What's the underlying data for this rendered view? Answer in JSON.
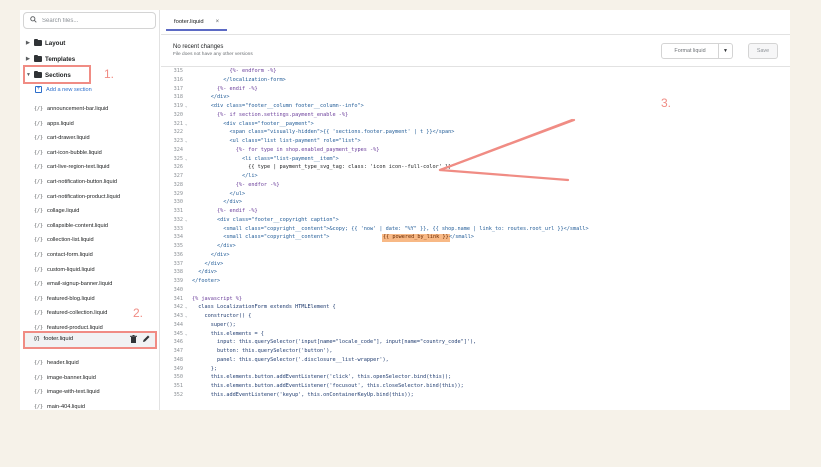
{
  "sidebar": {
    "search_placeholder": "Search files...",
    "folders": [
      {
        "label": "Layout",
        "caret": "▶"
      },
      {
        "label": "Templates",
        "caret": "▶"
      },
      {
        "label": "Sections",
        "caret": "▼"
      }
    ],
    "add_section_label": "Add a new section",
    "files": [
      "announcement-bar.liquid",
      "apps.liquid",
      "cart-drawer.liquid",
      "cart-icon-bubble.liquid",
      "cart-live-region-text.liquid",
      "cart-notification-button.liquid",
      "cart-notification-product.liquid",
      "collage.liquid",
      "collapsible-content.liquid",
      "collection-list.liquid",
      "contact-form.liquid",
      "custom-liquid.liquid",
      "email-signup-banner.liquid",
      "featured-blog.liquid",
      "featured-collection.liquid",
      "featured-product.liquid"
    ],
    "active_file": "footer.liquid",
    "files_after": [
      "header.liquid",
      "image-banner.liquid",
      "image-with-text.liquid",
      "main-404.liquid"
    ],
    "file_icon": "{/}"
  },
  "annotations": {
    "step1": "1.",
    "step2": "2.",
    "step3": "3.",
    "color": "#f08c84"
  },
  "editor": {
    "tab_label": "footer.liquid",
    "tab_close": "×",
    "no_changes_title": "No recent changes",
    "no_changes_sub": "File does not have any other versions",
    "format_label": "Format liquid",
    "format_caret": "▼",
    "save_label": "Save"
  },
  "code_lines": [
    {
      "n": "315",
      "f": "",
      "t": "            {%- endform -%}",
      "c": "kw"
    },
    {
      "n": "316",
      "f": "",
      "t": "          </localization-form>",
      "c": "tag"
    },
    {
      "n": "317",
      "f": "",
      "t": "        {%- endif -%}",
      "c": "kw"
    },
    {
      "n": "318",
      "f": "",
      "t": "      </div>",
      "c": "tag"
    },
    {
      "n": "319",
      "f": "⌄",
      "t": "      <div class=\"footer__column footer__column--info\">",
      "c": "tag"
    },
    {
      "n": "320",
      "f": "",
      "t": "        {%- if section.settings.payment_enable -%}",
      "c": "kw"
    },
    {
      "n": "321",
      "f": "⌄",
      "t": "          <div class=\"footer__payment\">",
      "c": "tag"
    },
    {
      "n": "322",
      "f": "",
      "t": "            <span class=\"visually-hidden\">{{ 'sections.footer.payment' | t }}</span>",
      "c": "tag"
    },
    {
      "n": "323",
      "f": "⌄",
      "t": "            <ul class=\"list list-payment\" role=\"list\">",
      "c": "tag"
    },
    {
      "n": "324",
      "f": "",
      "t": "              {%- for type in shop.enabled_payment_types -%}",
      "c": "kw"
    },
    {
      "n": "325",
      "f": "⌄",
      "t": "                <li class=\"list-payment__item\">",
      "c": "tag"
    },
    {
      "n": "326",
      "f": "",
      "t": "                  {{ type | payment_type_svg_tag: class: 'icon icon--full-color' }}",
      "c": ""
    },
    {
      "n": "327",
      "f": "",
      "t": "                </li>",
      "c": "tag"
    },
    {
      "n": "328",
      "f": "",
      "t": "              {%- endfor -%}",
      "c": "kw"
    },
    {
      "n": "329",
      "f": "",
      "t": "            </ul>",
      "c": "tag"
    },
    {
      "n": "330",
      "f": "",
      "t": "          </div>",
      "c": "tag"
    },
    {
      "n": "331",
      "f": "",
      "t": "        {%- endif -%}",
      "c": "kw"
    },
    {
      "n": "332",
      "f": "⌄",
      "t": "        <div class=\"footer__copyright caption\">",
      "c": "tag"
    },
    {
      "n": "333",
      "f": "",
      "t": "          <small class=\"copyright__content\">&copy; {{ 'now' | date: \"%Y\" }}, {{ shop.name | link_to: routes.root_url }}</small>",
      "c": "tag"
    },
    {
      "n": "334",
      "f": "",
      "t": "          <small class=\"copyright__content\">",
      "c": "tag",
      "mark": "{{ powered_by_link }}",
      "after": "</small>"
    },
    {
      "n": "335",
      "f": "",
      "t": "        </div>",
      "c": "tag"
    },
    {
      "n": "336",
      "f": "",
      "t": "      </div>",
      "c": "tag"
    },
    {
      "n": "337",
      "f": "",
      "t": "    </div>",
      "c": "tag"
    },
    {
      "n": "338",
      "f": "",
      "t": "  </div>",
      "c": "tag"
    },
    {
      "n": "339",
      "f": "",
      "t": "</footer>",
      "c": "tag"
    },
    {
      "n": "340",
      "f": "",
      "t": "",
      "c": ""
    },
    {
      "n": "341",
      "f": "",
      "t": "{% javascript %}",
      "c": "kw"
    },
    {
      "n": "342",
      "f": "⌄",
      "t": "  class LocalizationForm extends HTMLElement {",
      "c": "js"
    },
    {
      "n": "343",
      "f": "⌄",
      "t": "    constructor() {",
      "c": "js"
    },
    {
      "n": "344",
      "f": "",
      "t": "      super();",
      "c": "js"
    },
    {
      "n": "345",
      "f": "⌄",
      "t": "      this.elements = {",
      "c": "js"
    },
    {
      "n": "346",
      "f": "",
      "t": "        input: this.querySelector('input[name=\"locale_code\"], input[name=\"country_code\"]'),",
      "c": "js"
    },
    {
      "n": "347",
      "f": "",
      "t": "        button: this.querySelector('button'),",
      "c": "js"
    },
    {
      "n": "348",
      "f": "",
      "t": "        panel: this.querySelector('.disclosure__list-wrapper'),",
      "c": "js"
    },
    {
      "n": "349",
      "f": "",
      "t": "      };",
      "c": "js"
    },
    {
      "n": "350",
      "f": "",
      "t": "      this.elements.button.addEventListener('click', this.openSelector.bind(this));",
      "c": "js"
    },
    {
      "n": "351",
      "f": "",
      "t": "      this.elements.button.addEventListener('focusout', this.closeSelector.bind(this));",
      "c": "js"
    },
    {
      "n": "352",
      "f": "",
      "t": "      this.addEventListener('keyup', this.onContainerKeyUp.bind(this));",
      "c": "js"
    }
  ]
}
